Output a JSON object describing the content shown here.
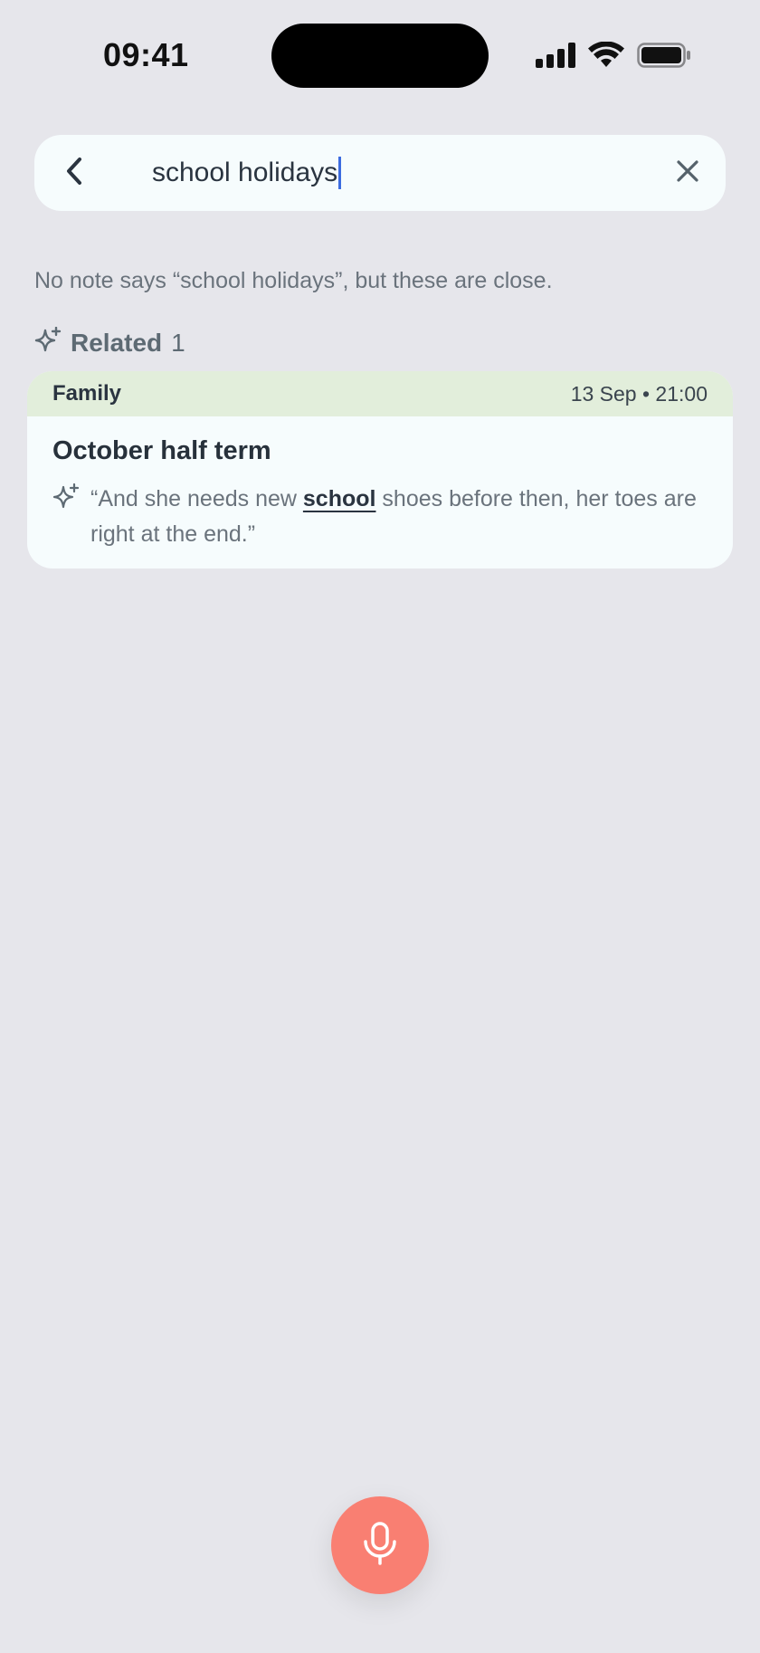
{
  "status_bar": {
    "time": "09:41"
  },
  "search": {
    "query": "school holidays"
  },
  "hint": {
    "text": "No note says “school holidays”, but these are close."
  },
  "section": {
    "title": "Related",
    "count": "1"
  },
  "results": [
    {
      "label": "Family",
      "date": "13 Sep • 21:00",
      "title": "October half term",
      "snippet_before": "“And she needs new ",
      "snippet_match": "school",
      "snippet_after": " shoes before then, her toes are right at the end.”",
      "header_color": "#E2EEDB"
    }
  ],
  "colors": {
    "background": "#E6E6EB",
    "card": "#F6FCFD",
    "accent_mic": "#F97F72",
    "caret": "#3C6CE0"
  },
  "icons": {
    "back": "chevron-left-icon",
    "clear": "close-icon",
    "related": "sparkle-icon",
    "mic": "microphone-icon"
  }
}
